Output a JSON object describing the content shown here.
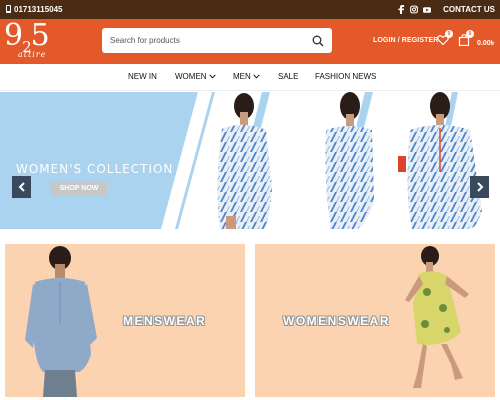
{
  "topbar": {
    "phone": "01713115045",
    "contact_label": "CONTACT US",
    "social_icons": [
      "facebook-icon",
      "instagram-icon",
      "youtube-icon"
    ]
  },
  "header": {
    "logo_digits": "925",
    "logo_first": "9",
    "logo_sub": "2",
    "logo_last": "5",
    "logo_tagline": "attire",
    "search_placeholder": "Search for products",
    "login_label": "LOGIN / REGISTER",
    "wishlist_count": "0",
    "cart_count": "0",
    "cart_total": "0.00৳"
  },
  "nav": {
    "items": [
      {
        "label": "NEW IN"
      },
      {
        "label": "WOMEN"
      },
      {
        "label": "MEN"
      },
      {
        "label": "SALE"
      },
      {
        "label": "FASHION NEWS"
      }
    ]
  },
  "hero": {
    "title": "WOMEN'S COLLECTION",
    "button_label": "SHOP NOW"
  },
  "categories": [
    {
      "label": "MENSWEAR"
    },
    {
      "label": "WOMENSWEAR"
    }
  ],
  "colors": {
    "topbar": "#4a2c14",
    "header": "#e4592a",
    "hero_bg": "#a9d3ee",
    "tile_bg": "#fbd3b0"
  }
}
